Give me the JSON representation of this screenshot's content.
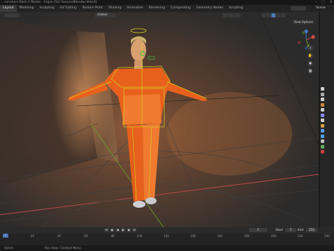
{
  "window": {
    "title": "...ranchers Pack 2 Model - Copie (52) Source/Blender.blend]",
    "controls": [
      "minimize-icon",
      "maximize-icon",
      "close-icon"
    ]
  },
  "workspaces": {
    "tabs": [
      "Layout",
      "Modeling",
      "Sculpting",
      "UV Editing",
      "Texture Paint",
      "Shading",
      "Animation",
      "Rendering",
      "Compositing",
      "Geometry Nodes",
      "Scripting"
    ],
    "active": "Layout",
    "scene_label": "Scene"
  },
  "viewport": {
    "orientation": "Global",
    "view_options": "View Options",
    "nav_icons": [
      "zoom-icon",
      "pan-icon",
      "camera-view-icon",
      "grid-icon"
    ],
    "colors": {
      "character": "#e8611c",
      "armature": "#d8d020",
      "axis_x": "#c24a4a",
      "axis_y": "#6c9a2b",
      "selected_bone": "#40c040"
    }
  },
  "properties": {
    "tab_colors": [
      "#d0d0d0",
      "#b0b0b0",
      "#cfcfcf",
      "#d08a38",
      "#cfcfcf",
      "#8a8aff",
      "#cfcfcf",
      "#d9a040",
      "#5aa0ff",
      "#4aa0ff",
      "#c0c0c0",
      "#60b060",
      "#d04040"
    ]
  },
  "timeline": {
    "playback_icons": [
      "jump-start-icon",
      "prev-keyframe-icon",
      "play-reverse-icon",
      "play-icon",
      "next-keyframe-icon",
      "jump-end-icon"
    ],
    "current_frame": "1",
    "start_label": "Start",
    "start_value": "1",
    "end_label": "End",
    "end_value": "250",
    "ruler_labels": [
      "0",
      "20",
      "40",
      "60",
      "80",
      "100",
      "120",
      "140",
      "160",
      "180",
      "200",
      "220",
      "240"
    ],
    "marker_frame": "1"
  },
  "status": {
    "left": "Select",
    "middle": "Pan View / Context Menu"
  }
}
